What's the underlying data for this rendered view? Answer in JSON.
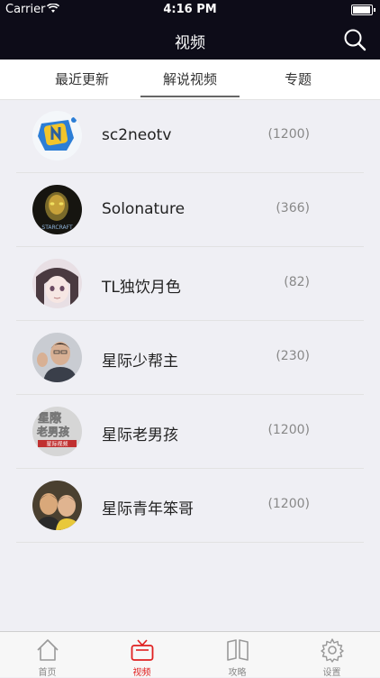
{
  "status": {
    "carrier": "Carrier",
    "time": "4:16 PM",
    "battery_level": 0.95
  },
  "navbar": {
    "title": "视频",
    "search_icon": "search-icon"
  },
  "segments": [
    {
      "label": "最近更新",
      "active": false
    },
    {
      "label": "解说视频",
      "active": true
    },
    {
      "label": "专题",
      "active": false
    }
  ],
  "casters": [
    {
      "name": "sc2neotv",
      "count": "(1200)"
    },
    {
      "name": "Solonature",
      "count": "(366)"
    },
    {
      "name": "TL独饮月色",
      "count": "(82)"
    },
    {
      "name": "星际少帮主",
      "count": "(230)"
    },
    {
      "name": "星际老男孩",
      "count": "(1200)"
    },
    {
      "name": "星际青年笨哥",
      "count": "(1200)"
    }
  ],
  "avatar_texts": {
    "starcraft": "STARCRAFT",
    "old_boy_line1": "星際",
    "old_boy_line2": "老男孩",
    "old_boy_line3": "星际视频"
  },
  "tabs": [
    {
      "label": "首页",
      "icon": "home-icon",
      "active": false
    },
    {
      "label": "视频",
      "icon": "tv-icon",
      "active": true
    },
    {
      "label": "攻略",
      "icon": "book-icon",
      "active": false
    },
    {
      "label": "设置",
      "icon": "gear-icon",
      "active": false
    }
  ],
  "colors": {
    "bar": "#0d0c18",
    "accent": "#e02020"
  }
}
